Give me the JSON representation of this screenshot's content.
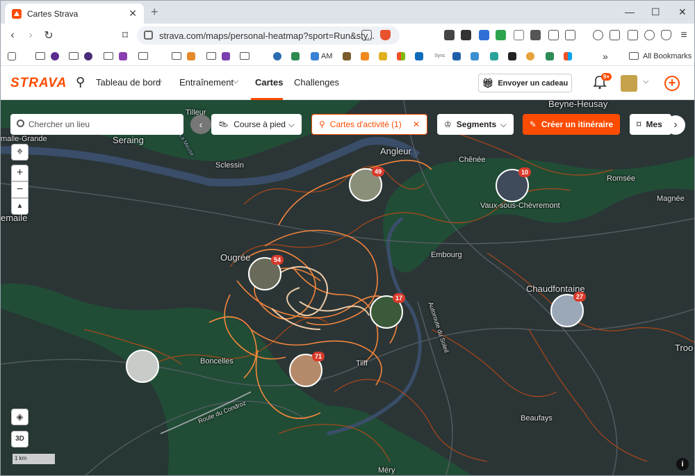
{
  "browser": {
    "tab_title": "Cartes Strava",
    "url": "strava.com/maps/personal-heatmap?sport=Run&sty...",
    "bookmarks_label": "All Bookmarks",
    "bookmark_am": "AM",
    "bookmark_sync": "Sync"
  },
  "strava": {
    "logo": "STRAVA",
    "nav": [
      "Tableau de bord",
      "Entraînement",
      "Cartes",
      "Challenges"
    ],
    "gift_button": "Envoyer un cadeau",
    "notif_badge": "9+",
    "accent": "#fc4c02"
  },
  "map": {
    "search_placeholder": "Chercher un lieu",
    "sport_filter": "Course à pied",
    "activity_filter": "Cartes d'activité (1)",
    "segments": "Segments",
    "create_route": "Créer un itinéraire",
    "more_label": "Mes",
    "btn_3d": "3D",
    "scale": "1 km",
    "places": [
      "Tilleur",
      "Beyne-Heusay",
      "Seraing",
      "Sclessin",
      "Angleur",
      "Chênée",
      "Vaux-sous-Chèvremont",
      "Romsée",
      "Magnée",
      "Ougrée",
      "Embourg",
      "Chaudfontaine",
      "Boncelles",
      "Tilff",
      "Beaufays",
      "Méry",
      "malle-Grande",
      "emaile",
      "Troo",
      "Route du Condroz",
      "Autoroute du Soleil",
      "La Meuse"
    ],
    "pins": [
      "49",
      "10",
      "54",
      "17",
      "27",
      "71",
      ""
    ]
  }
}
